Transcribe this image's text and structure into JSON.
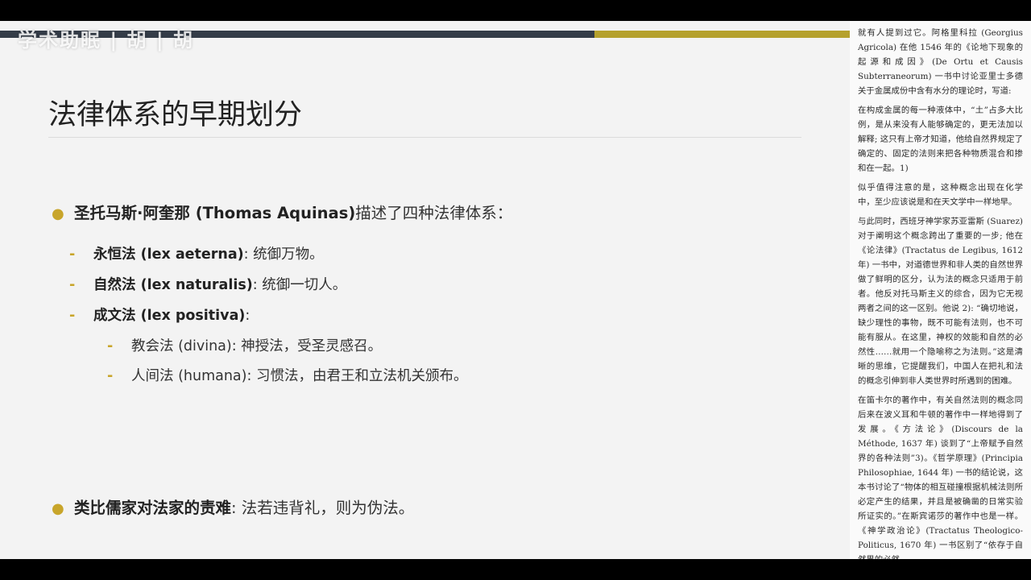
{
  "slide": {
    "watermark": "学术助眠 | 胡 | 胡",
    "title": "法律体系的早期划分",
    "colors": {
      "stripe_dark": "#343c48",
      "stripe_gold": "#b5a12d",
      "bullet_accent": "#c8a52a"
    },
    "bullets": [
      {
        "bold": "圣托马斯·阿奎那 (Thomas Aquinas)",
        "text": " 描述了四种法律体系："
      },
      {
        "bold": "类比儒家对法家的责难",
        "text": ": 法若违背礼，则为伪法。"
      }
    ],
    "sub_items": [
      {
        "bold": "永恒法 (lex aeterna)",
        "text": ": 统御万物。"
      },
      {
        "bold": "自然法 (lex naturalis)",
        "text": ": 统御一切人。"
      },
      {
        "bold": "成文法 (lex positiva)",
        "text": ":"
      }
    ],
    "sub_sub_items": [
      {
        "text": "教会法 (divina): 神授法，受圣灵感召。"
      },
      {
        "text": "人间法 (humana): 习惯法，由君王和立法机关颁布。"
      }
    ]
  },
  "sidebar": {
    "paragraphs": [
      "就有人提到过它。阿格里科拉 (Georgius Agricola) 在他 1546 年的《论地下现象的起源和成因》(De Ortu et Causis Subterraneorum) 一书中讨论亚里士多德关于金属成份中含有水分的理论时，写道:",
      "在构成金属的每一种液体中，“土”占多大比例，是从来没有人能够确定的，更无法加以解释; 这只有上帝才知道，他给自然界规定了确定的、固定的法则来把各种物质混合和掺和在一起。1)",
      "似乎值得注意的是，这种概念出现在化学中，至少应该说是和在天文学中一样地早。",
      "与此同时，西班牙神学家苏亚雷斯 (Suarez) 对于阐明这个概念跨出了重要的一步; 他在《论法律》(Tractatus de Legibus, 1612 年) 一书中，对道德世界和非人类的自然世界做了鲜明的区分，认为法的概念只适用于前者。他反对托马斯主义的综合，因为它无视两者之间的这一区别。他说 2): “确切地说，缺少理性的事物，既不可能有法则，也不可能有服从。在这里，神权的效能和自然的必然性……就用一个隐喻称之为法则。”这是清晰的思维，它提醒我们，中国人在把礼和法的概念引伸到非人类世界时所遇到的困难。",
      "在笛卡尔的著作中，有关自然法则的概念同后来在波义耳和牛顿的著作中一样地得到了发展。《方法论》(Discours de la Méthode, 1637 年) 谈到了“上帝赋予自然界的各种法则”3)。《哲学原理》(Principia Philosophiae, 1644 年) 一书的结论说，这本书讨论了“物体的相互碰撞根据机械法则所必定产生的结果，并且是被确凿的日常实验所证实的。”在斯宾诺莎的著作中也是一样。《神学政治论》(Tractatus Theologico-Politicus, 1670 年) 一书区别了“依存于自然界的必然"
    ]
  }
}
